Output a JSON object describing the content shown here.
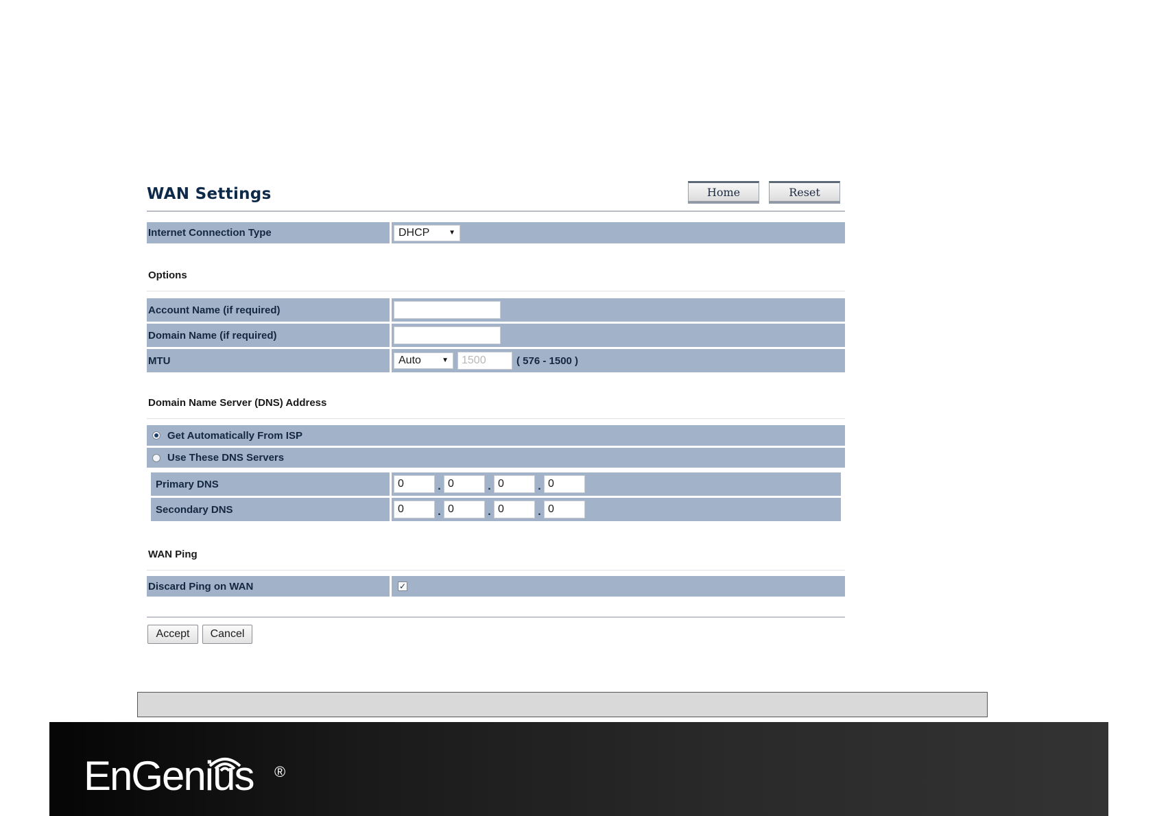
{
  "header": {
    "title": "WAN Settings",
    "home_label": "Home",
    "reset_label": "Reset"
  },
  "connection": {
    "label": "Internet Connection Type",
    "value": "DHCP"
  },
  "options": {
    "section_title": "Options",
    "account_name_label": "Account Name (if required)",
    "account_name_value": "",
    "domain_name_label": "Domain Name (if required)",
    "domain_name_value": "",
    "mtu_label": "MTU",
    "mtu_mode": "Auto",
    "mtu_value": "1500",
    "mtu_range": "( 576 - 1500 )"
  },
  "dns": {
    "section_title": "Domain Name Server (DNS) Address",
    "auto_label": "Get Automatically From ISP",
    "manual_label": "Use These DNS Servers",
    "selected": "auto",
    "primary_label": "Primary DNS",
    "primary": [
      "0",
      "0",
      "0",
      "0"
    ],
    "secondary_label": "Secondary DNS",
    "secondary": [
      "0",
      "0",
      "0",
      "0"
    ],
    "separator": "."
  },
  "ping": {
    "section_title": "WAN Ping",
    "discard_label": "Discard Ping on WAN",
    "discard_checked": true,
    "check_glyph": "✓"
  },
  "actions": {
    "accept_label": "Accept",
    "cancel_label": "Cancel"
  },
  "footer": {
    "brand": "EnGenius",
    "registered": "®"
  },
  "colors": {
    "row_background": "#a2b2c8",
    "label_text": "#132840",
    "title_text": "#0e2a4a"
  }
}
